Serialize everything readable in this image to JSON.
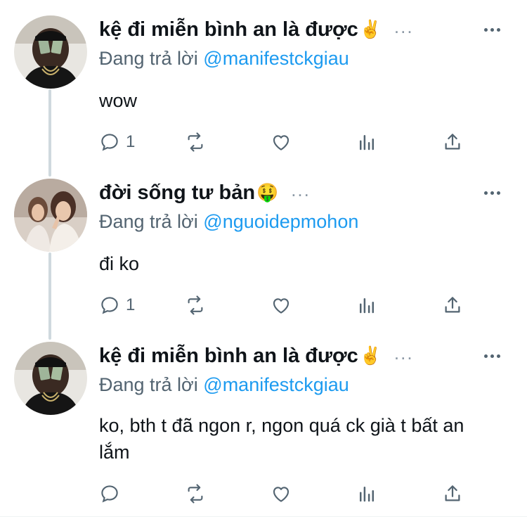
{
  "tweets": [
    {
      "display_name": "kệ đi miễn bình an là được",
      "emoji": "✌️",
      "inline_more": "...",
      "reply_prefix": "Đang trả lời",
      "reply_handle": "@manifestckgiau",
      "text": "wow",
      "reply_count": "1",
      "avatar": "avatar-money-face"
    },
    {
      "display_name": "đời sống tư bản",
      "emoji": "🤑",
      "inline_more": "...",
      "reply_prefix": "Đang trả lời",
      "reply_handle": "@nguoidepmohon",
      "text": "đi ko",
      "reply_count": "1",
      "avatar": "avatar-two-women"
    },
    {
      "display_name": "kệ đi miễn bình an là được",
      "emoji": "✌️",
      "inline_more": "...",
      "reply_prefix": "Đang trả lời",
      "reply_handle": "@manifestckgiau",
      "text": "ko, bth t đã ngon r, ngon quá ck già t bất an lắm",
      "reply_count": "",
      "avatar": "avatar-money-face"
    }
  ],
  "icons": {
    "reply": "reply-icon",
    "retweet": "retweet-icon",
    "like": "heart-icon",
    "views": "analytics-icon",
    "share": "share-icon",
    "more": "more-icon"
  },
  "colors": {
    "handle": "#1d9bf0",
    "secondary_text": "#536471",
    "thread_line": "#cfd9de"
  }
}
